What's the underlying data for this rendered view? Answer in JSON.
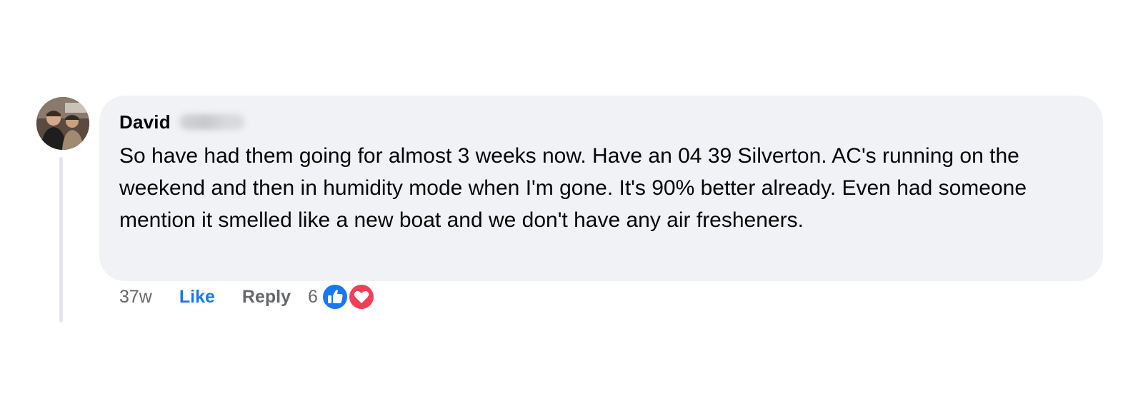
{
  "comment": {
    "author_name": "David",
    "author_surname_redacted": true,
    "text": "So have had them going for almost 3 weeks now. Have an 04 39 Silverton. AC's running on the weekend and then in humidity mode when I'm gone. It's 90% better already. Even had someone mention it smelled like a new boat and we don't have any air fresheners.",
    "avatar_icon": "profile-photo"
  },
  "actions": {
    "timestamp": "37w",
    "like_label": "Like",
    "reply_label": "Reply"
  },
  "reactions": {
    "count": "6",
    "types": [
      "like-icon",
      "love-icon"
    ]
  },
  "colors": {
    "bubble_bg": "#f0f2f5",
    "like_blue": "#1877f2",
    "love_red": "#f33e58",
    "secondary_text": "#65676b",
    "primary_text": "#050505"
  }
}
